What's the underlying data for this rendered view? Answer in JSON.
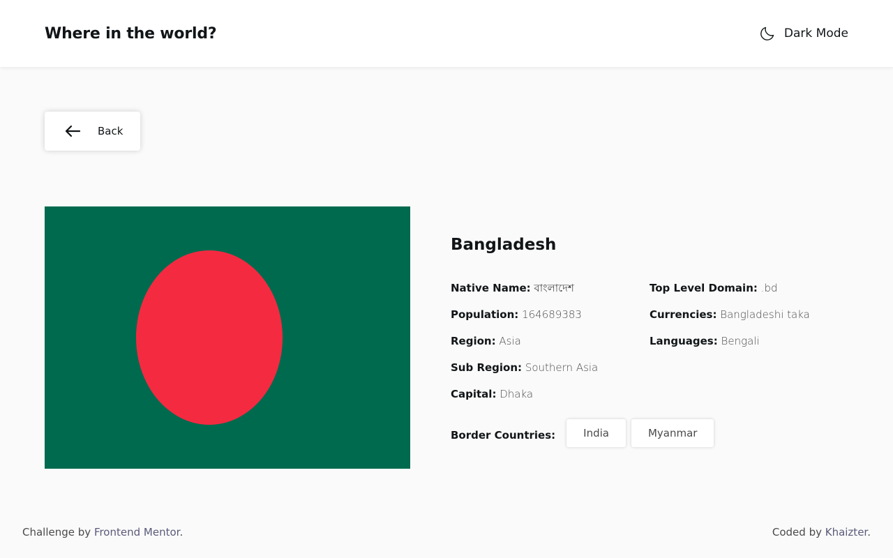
{
  "header": {
    "title": "Where in the world?",
    "theme_toggle_label": "Dark Mode",
    "theme_icon": "moon-icon"
  },
  "back": {
    "label": "Back",
    "icon": "arrow-left-icon"
  },
  "country": {
    "name": "Bangladesh",
    "flag_colors": {
      "field": "#006a4e",
      "disc": "#f42a41"
    },
    "left_info": [
      {
        "label": "Native Name:",
        "value": "বাংলাদেশ"
      },
      {
        "label": "Population:",
        "value": "164689383"
      },
      {
        "label": "Region:",
        "value": "Asia"
      },
      {
        "label": "Sub Region:",
        "value": "Southern Asia"
      },
      {
        "label": "Capital:",
        "value": "Dhaka"
      }
    ],
    "right_info": [
      {
        "label": "Top Level Domain:",
        "value": ".bd"
      },
      {
        "label": "Currencies:",
        "value": "Bangladeshi taka"
      },
      {
        "label": "Languages:",
        "value": "Bengali"
      }
    ],
    "border_label": "Border Countries:",
    "borders": [
      "India",
      "Myanmar"
    ]
  },
  "footer": {
    "left_prefix": "Challenge by ",
    "left_link": "Frontend Mentor",
    "left_suffix": ".",
    "right_prefix": "Coded by ",
    "right_link": "Khaizter",
    "right_suffix": "."
  }
}
